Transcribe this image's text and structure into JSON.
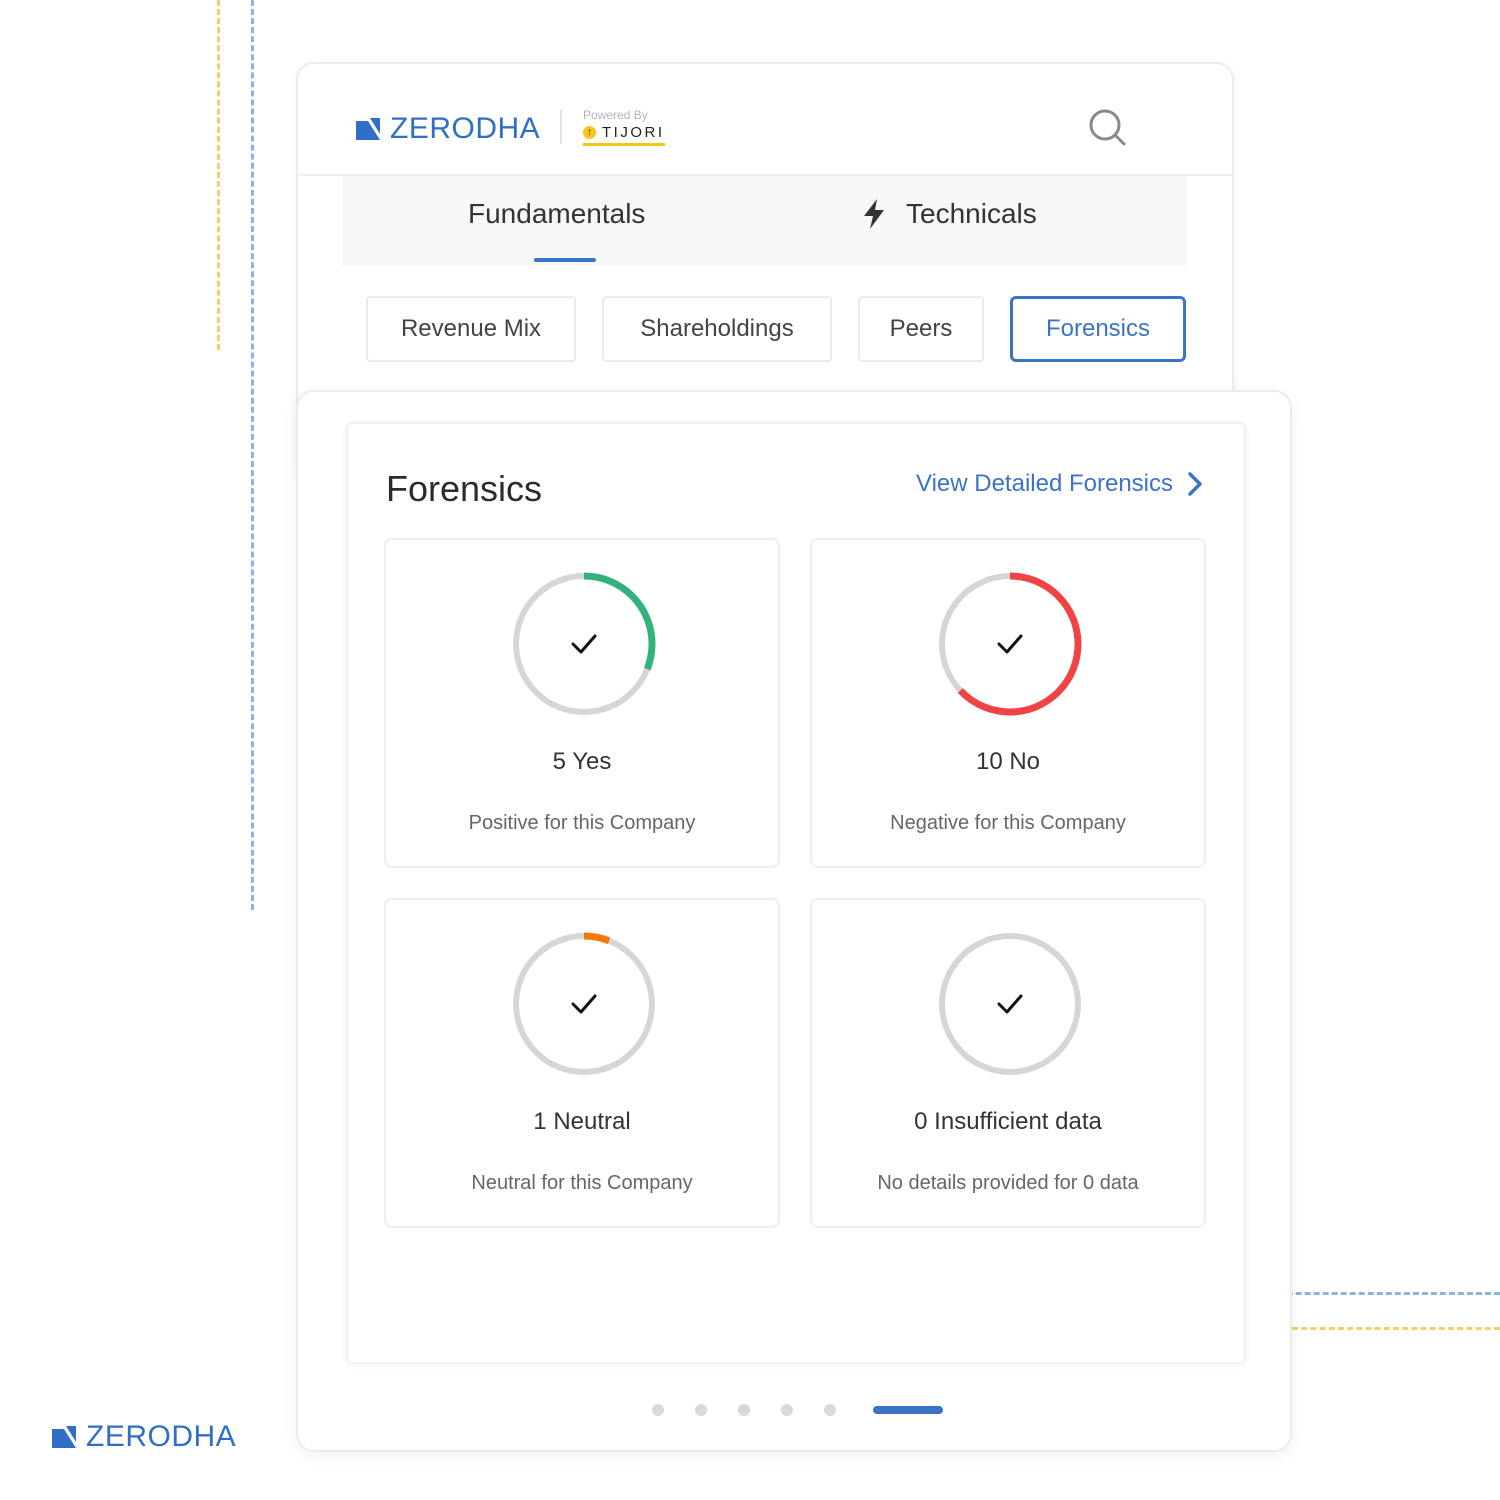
{
  "brand": {
    "name": "ZERODHA",
    "powered_by_label": "Powered By",
    "partner": "TIJORI",
    "color": "#2f6fc5"
  },
  "main_tabs": [
    {
      "label": "Fundamentals",
      "active": true
    },
    {
      "label": "Technicals",
      "active": false,
      "icon": "lightning-icon"
    }
  ],
  "sub_tabs": [
    {
      "label": "Revenue Mix",
      "active": false
    },
    {
      "label": "Shareholdings",
      "active": false
    },
    {
      "label": "Peers",
      "active": false
    },
    {
      "label": "Forensics",
      "active": true
    }
  ],
  "panel": {
    "title": "Forensics",
    "link_label": "View Detailed Forensics"
  },
  "stats": [
    {
      "count_label": "5 Yes",
      "description": "Positive for this Company",
      "value": 5,
      "fraction": 0.31,
      "color": "#34b27b"
    },
    {
      "count_label": "10 No",
      "description": "Negative for this Company",
      "value": 10,
      "fraction": 0.63,
      "color": "#f04444"
    },
    {
      "count_label": "1 Neutral",
      "description": "Neutral for this Company",
      "value": 1,
      "fraction": 0.06,
      "color": "#f07a0a"
    },
    {
      "count_label": "0 Insufficient data",
      "description": "No details provided for 0 data",
      "value": 0,
      "fraction": 0,
      "color": "#d6d6d6"
    }
  ],
  "pagination": {
    "total": 6,
    "active_index": 5
  },
  "colors": {
    "accent": "#3b73c8",
    "track": "#d6d6d6"
  }
}
